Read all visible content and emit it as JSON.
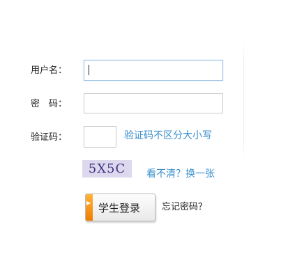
{
  "form": {
    "username_label": "用户名：",
    "password_label": "密　码：",
    "captcha_label": "验证码：",
    "username_value": "",
    "password_value": "",
    "captcha_value": "",
    "captcha_hint": "验证码不区分大小写",
    "captcha_image_text": "5X5C",
    "refresh_captcha": "看不清？换一张",
    "login_button": "学生登录",
    "forgot_password": "忘记密码？"
  },
  "colors": {
    "link": "#3a8fcd",
    "button_accent": "#f07d00",
    "captcha_bg": "#ddd8ee",
    "focus_border": "#9ec3e8"
  }
}
